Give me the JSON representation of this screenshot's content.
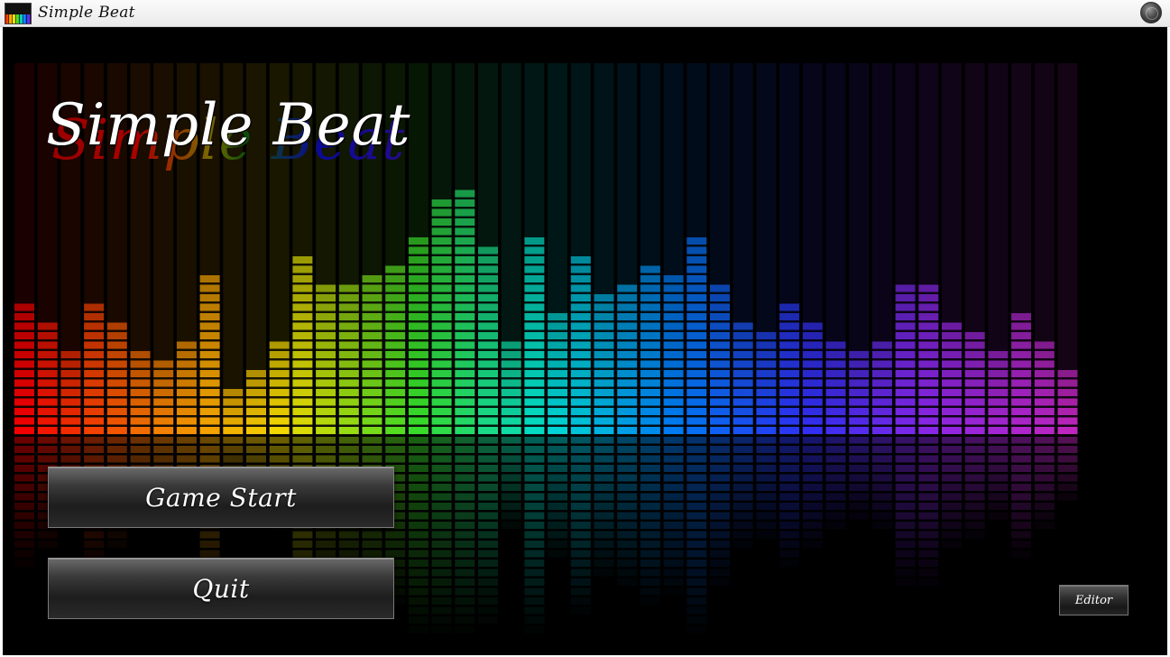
{
  "window": {
    "title": "Simple Beat",
    "app_icon": "equalizer-app-icon",
    "control_icon": "round-orb-button"
  },
  "logo": {
    "text": "Simple Beat"
  },
  "menu": {
    "start_label": "Game Start",
    "quit_label": "Quit",
    "editor_label": "Editor"
  },
  "theme": {
    "background": "#000000",
    "spectrum_colors": [
      "#ff0000",
      "#ff8000",
      "#ffff00",
      "#33ff33",
      "#00ffdd",
      "#0080ff",
      "#3333ff",
      "#9933ff",
      "#cc33cc"
    ]
  }
}
